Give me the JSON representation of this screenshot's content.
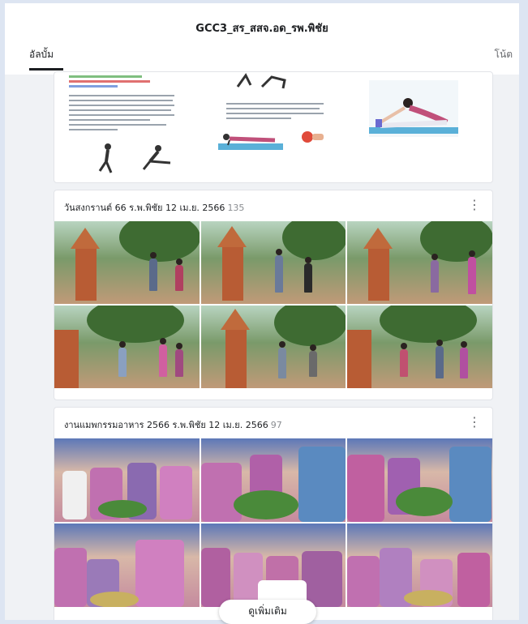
{
  "header": {
    "title": "GCC3_สร_สสจ.อด_รพ.พิชัย",
    "tab_albums": "อัลบั้ม",
    "tab_notes": "โน้ต"
  },
  "albums": [
    {
      "name": "วันสงกรานต์ 66 ร.พ.พิชัย 12 เม.ย. 2566",
      "count": "135"
    },
    {
      "name": "งานแมพกรรมอาหาร 2566 ร.พ.พิชัย 12 เม.ย. 2566",
      "count": "97"
    }
  ],
  "more_icon": "⋮",
  "bottom_pill": "ดูเพิ่มเติม",
  "colors": {
    "accent": "#1c1e21",
    "background": "#dde5f2",
    "card": "#ffffff"
  }
}
